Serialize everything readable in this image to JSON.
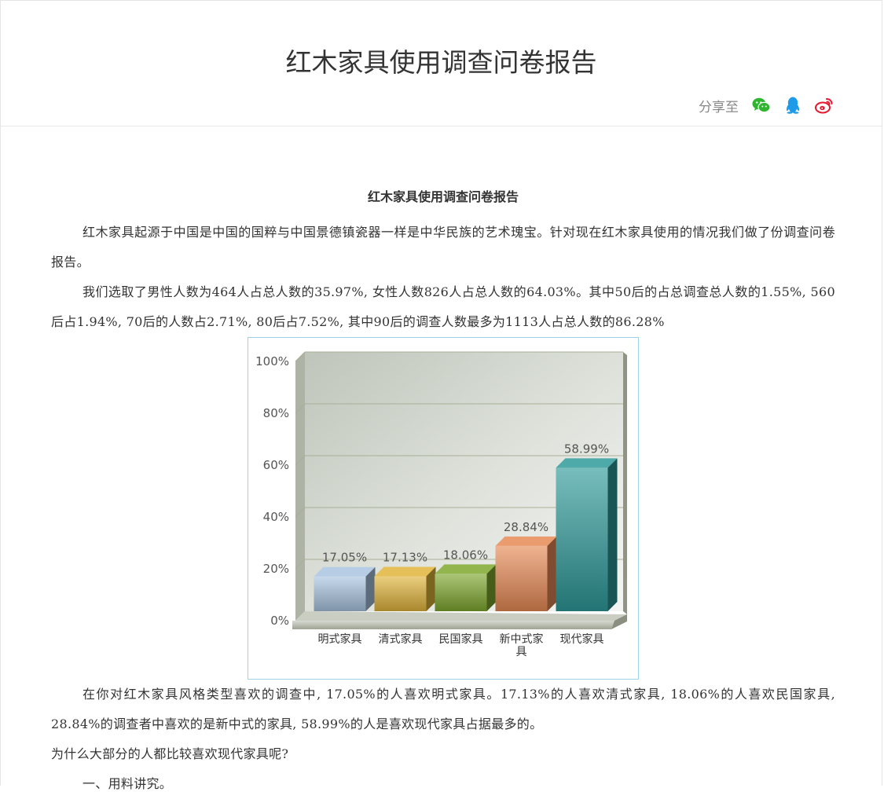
{
  "header": {
    "title": "红木家具使用调查问卷报告",
    "share_label": "分享至",
    "share_icons": [
      "wechat-icon",
      "qq-icon",
      "weibo-icon"
    ]
  },
  "article": {
    "title": "红木家具使用调查问卷报告",
    "p1": "红木家具起源于中国是中国的国粹与中国景德镇瓷器一样是中华民族的艺术瑰宝。针对现在红木家具使用的情况我们做了份调查问卷报告。",
    "p2": "我们选取了男性人数为464人占总人数的35.97%, 女性人数826人占总人数的64.03%。其中50后的占总调查总人数的1.55%, 560后占1.94%, 70后的人数占2.71%, 80后占7.52%, 其中90后的调查人数最多为1113人占总人数的86.28%",
    "p3": "在你对红木家具风格类型喜欢的调查中, 17.05%的人喜欢明式家具。17.13%的人喜欢清式家具, 18.06%的人喜欢民国家具, 28.84%的调查者中喜欢的是新中式的家具, 58.99%的人是喜欢现代家具占据最多的。",
    "p4": "为什么大部分的人都比较喜欢现代家具呢?",
    "p5": "一、用料讲究。"
  },
  "chart_data": {
    "type": "bar",
    "categories": [
      "明式家具",
      "清式家具",
      "民国家具",
      "新中式家具",
      "现代家具"
    ],
    "values": [
      17.05,
      17.13,
      18.06,
      28.84,
      58.99
    ],
    "value_labels": [
      "17.05%",
      "17.13%",
      "18.06%",
      "28.84%",
      "58.99%"
    ],
    "y_ticks": [
      "0%",
      "20%",
      "40%",
      "60%",
      "80%",
      "100%"
    ],
    "ylim": [
      0,
      100
    ],
    "title": "",
    "xlabel": "",
    "ylabel": "",
    "grid": true,
    "colors": [
      "#a9c4e0",
      "#e0b43a",
      "#7fa82e",
      "#e88a55",
      "#2f9a9a"
    ]
  }
}
